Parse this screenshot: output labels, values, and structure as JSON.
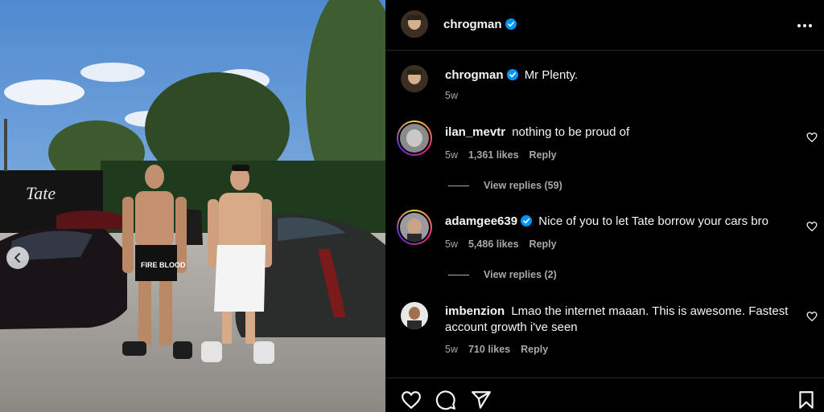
{
  "post": {
    "author": "chrogman",
    "verified": true,
    "image": {
      "signage_text": "Tate",
      "shorts_text": "FIRE BLOOD"
    }
  },
  "caption": {
    "username": "chrogman",
    "text": "Mr Plenty.",
    "time": "5w"
  },
  "comments": [
    {
      "username": "ilan_mevtr",
      "verified": false,
      "text": "nothing to be proud of",
      "time": "5w",
      "likes": "1,361 likes",
      "reply_label": "Reply",
      "view_replies": "View replies (59)"
    },
    {
      "username": "adamgee639",
      "verified": true,
      "text": "Nice of you to let Tate borrow your cars bro",
      "time": "5w",
      "likes": "5,486 likes",
      "reply_label": "Reply",
      "view_replies": "View replies (2)"
    },
    {
      "username": "imbenzion",
      "verified": false,
      "text_line1": "Lmao the internet maaan. This is awesome. Fastest",
      "text_line2": "account growth i've seen",
      "time": "5w",
      "likes": "710 likes",
      "reply_label": "Reply"
    }
  ],
  "icons": {
    "more": "more-options-icon",
    "like": "heart-icon",
    "comment": "comment-icon",
    "share": "share-icon",
    "save": "bookmark-icon",
    "prev": "chevron-left-icon",
    "verified": "verified-badge-icon"
  },
  "colors": {
    "verified": "#0095f6",
    "background": "#000000",
    "secondary_text": "#a8a8a8"
  }
}
